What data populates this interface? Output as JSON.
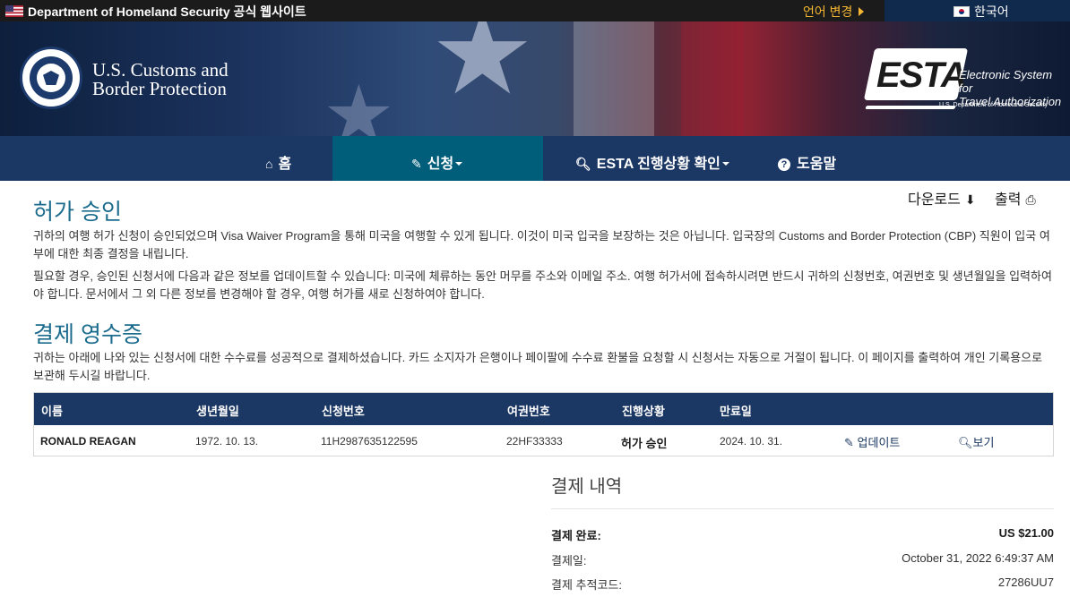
{
  "govbar": {
    "text": "Department of Homeland Security 공식 웹사이트",
    "language_change": "언어 변경",
    "current_language": "한국어"
  },
  "header": {
    "agency_line1": "U.S. Customs and",
    "agency_line2": "Border Protection",
    "esta_word": "ESTA",
    "esta_full_line1": "Electronic System for",
    "esta_full_line2": "Travel Authorization",
    "esta_dhs": "U.S. Department of Homeland Security"
  },
  "nav": {
    "home": "홈",
    "apply": "신청",
    "check_status": "ESTA 진행상황 확인",
    "help": "도움말"
  },
  "tools": {
    "download": "다운로드",
    "print": "출력"
  },
  "approval": {
    "title": "허가 승인",
    "para1": "귀하의 여행 허가 신청이 승인되었으며 Visa Waiver Program을 통해 미국을 여행할 수 있게 됩니다. 이것이 미국 입국을 보장하는 것은 아닙니다. 입국장의 Customs and Border Protection (CBP) 직원이 입국 여부에 대한 최종 결정을 내립니다.",
    "para2": "필요할 경우, 승인된 신청서에 다음과 같은 정보를 업데이트할 수 있습니다: 미국에 체류하는 동안 머무를 주소와 이메일 주소. 여행 허가서에 접속하시려면 반드시 귀하의 신청번호, 여권번호 및 생년월일을 입력하여야 합니다. 문서에서 그 외 다른 정보를 변경해야 할 경우, 여행 허가를 새로 신청하여야 합니다."
  },
  "receipt": {
    "title": "결제 영수증",
    "para": "귀하는 아래에 나와 있는 신청서에 대한 수수료를 성공적으로 결제하셨습니다. 카드 소지자가 은행이나 페이팔에 수수료 환불을 요청할 시 신청서는 자동으로 거절이 됩니다. 이 페이지를 출력하여 개인 기록용으로 보관해 두시길 바랍니다."
  },
  "table": {
    "headers": [
      "이름",
      "생년월일",
      "신청번호",
      "여권번호",
      "진행상황",
      "만료일"
    ],
    "row": {
      "name": "RONALD REAGAN",
      "dob": "1972. 10. 13.",
      "application_no": "11H2987635122595",
      "passport_no": "22HF33333",
      "status": "허가 승인",
      "expiry": "2024. 10. 31.",
      "update_label": "업데이트",
      "view_label": "보기"
    }
  },
  "payment": {
    "title": "결제 내역",
    "paid_label": "결제 완료:",
    "paid_value": "US $21.00",
    "date_label": "결제일:",
    "date_value": "October 31, 2022 6:49:37 AM",
    "tracking_label": "결제 추적코드:",
    "tracking_value": "27286UU7"
  },
  "colors": {
    "nav_bg": "#1b3763",
    "nav_active": "#005e7a",
    "heading": "#1b6b8d",
    "lang_accent": "#f5b731"
  }
}
